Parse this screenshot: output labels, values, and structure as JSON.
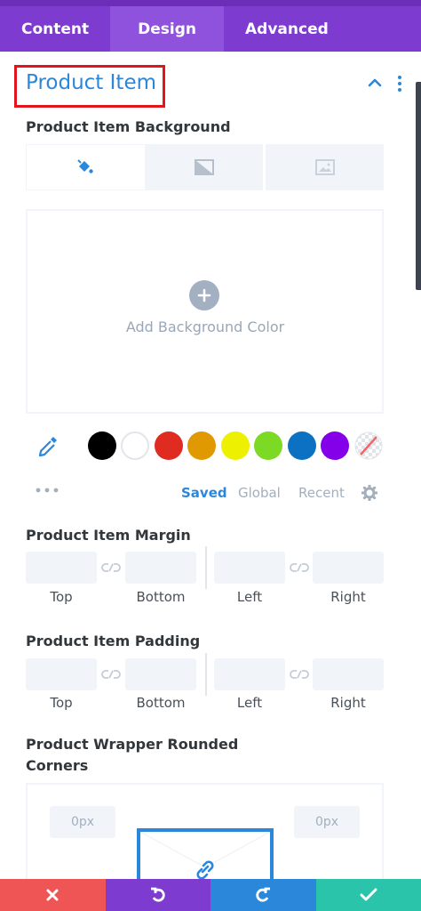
{
  "tabs": [
    "Content",
    "Design",
    "Advanced"
  ],
  "section": {
    "title": "Product Item"
  },
  "background": {
    "label": "Product Item Background",
    "add_color_label": "Add Background Color",
    "swatches": [
      "#000000",
      "#ffffff",
      "#e02b20",
      "#e09900",
      "#edf000",
      "#7cda24",
      "#0c71c3",
      "#8300e9"
    ],
    "palette_tabs": [
      "Saved",
      "Global",
      "Recent"
    ]
  },
  "margin": {
    "label": "Product Item Margin",
    "captions": [
      "Top",
      "Bottom",
      "Left",
      "Right"
    ]
  },
  "padding": {
    "label": "Product Item Padding",
    "captions": [
      "Top",
      "Bottom",
      "Left",
      "Right"
    ]
  },
  "rounded": {
    "label_line1": "Product Wrapper Rounded",
    "label_line2": "Corners",
    "top_left_value": "0px",
    "top_right_value": "0px"
  },
  "colors": {
    "accent": "#2b87da",
    "purple": "#7d3bcf",
    "cancel": "#ef5555",
    "undo": "#7e3bd0",
    "redo": "#2b87da",
    "save": "#29c4a9"
  }
}
